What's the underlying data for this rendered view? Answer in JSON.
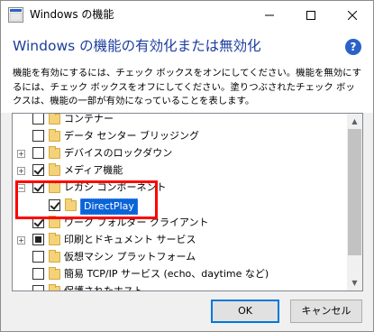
{
  "window": {
    "title": "Windows の機能",
    "minimize_icon": "minimize-icon",
    "maximize_icon": "maximize-icon",
    "close_icon": "close-icon"
  },
  "header": {
    "heading": "Windows の機能の有効化または無効化",
    "help_icon": "?",
    "description": "機能を有効にするには、チェック ボックスをオンにしてください。機能を無効にするには、チェック ボックスをオフにしてください。塗りつぶされたチェック ボックスは、機能の一部が有効になっていることを表します。"
  },
  "tree": {
    "items": [
      {
        "label": "コンテナー",
        "checked": "unchecked",
        "expandable": false
      },
      {
        "label": "データ センター ブリッジング",
        "checked": "unchecked",
        "expandable": false
      },
      {
        "label": "デバイスのロックダウン",
        "checked": "unchecked",
        "expandable": true
      },
      {
        "label": "メディア機能",
        "checked": "checked",
        "expandable": true
      },
      {
        "label": "レガシ コンポーネント",
        "checked": "checked",
        "expandable": true,
        "expanded": true
      },
      {
        "label": "DirectPlay",
        "checked": "checked",
        "expandable": false,
        "child": true,
        "selected": true
      },
      {
        "label": "ワーク フォルダー クライアント",
        "checked": "checked",
        "expandable": false
      },
      {
        "label": "印刷とドキュメント サービス",
        "checked": "partial",
        "expandable": true
      },
      {
        "label": "仮想マシン プラットフォーム",
        "checked": "unchecked",
        "expandable": false
      },
      {
        "label": "簡易 TCP/IP サービス (echo、daytime など)",
        "checked": "unchecked",
        "expandable": false
      },
      {
        "label": "保護されたホスト",
        "checked": "unchecked",
        "expandable": false
      }
    ]
  },
  "buttons": {
    "ok": "OK",
    "cancel": "キャンセル"
  },
  "colors": {
    "heading": "#1c3d9e",
    "selection": "#0a64d8",
    "highlight_box": "#ff0000",
    "folder": "#f3d27a"
  }
}
